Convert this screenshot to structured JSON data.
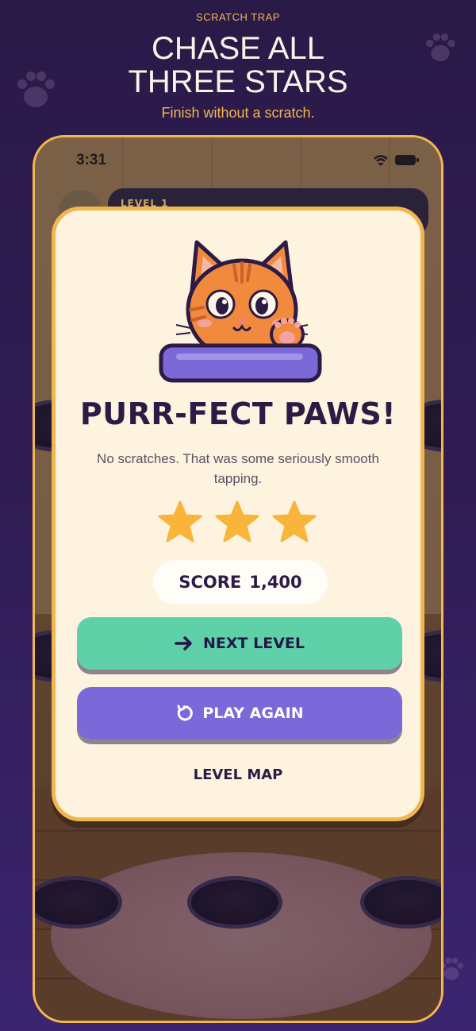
{
  "promo": {
    "eyebrow": "SCRATCH TRAP",
    "headline_line1": "CHASE ALL",
    "headline_line2": "THREE STARS",
    "subhead": "Finish without a scratch."
  },
  "device": {
    "status_time": "3:31",
    "level_label": "LEVEL 1"
  },
  "modal": {
    "title": "PURR-FECT PAWS!",
    "body": "No scratches. That was some seriously smooth tapping.",
    "stars_earned": 3,
    "stars_total": 3,
    "score_label": "SCORE",
    "score_value": "1,400",
    "next_level_label": "NEXT LEVEL",
    "play_again_label": "PLAY AGAIN",
    "level_map_label": "LEVEL MAP",
    "icons": {
      "next": "arrow-right-icon",
      "again": "replay-icon",
      "mascot": "cat-mascot-icon"
    }
  },
  "colors": {
    "background": "#2a1a48",
    "accent_gold": "#f2b650",
    "modal_bg": "#fdf3df",
    "next_button": "#5fd1a8",
    "again_button": "#7b68d9",
    "text_dark": "#2d1b46"
  }
}
